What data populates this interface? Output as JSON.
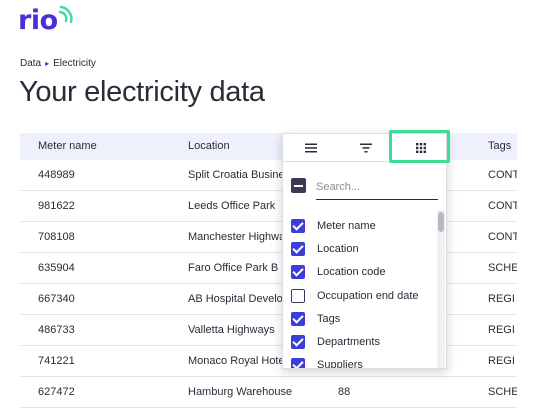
{
  "brand": {
    "logo_text": "rio",
    "accent": "#4b2fd6",
    "arc_color": "#3ddc97"
  },
  "breadcrumb": {
    "items": [
      "Data",
      "Electricity"
    ],
    "separator": "▸"
  },
  "page": {
    "title": "Your electricity data"
  },
  "table": {
    "columns": [
      "Meter name",
      "Location",
      "",
      "Tags"
    ],
    "rows": [
      {
        "meter": "448989",
        "location": "Split Croatia Business",
        "code": "",
        "tags": "CONT"
      },
      {
        "meter": "981622",
        "location": "Leeds Office Park",
        "code": "",
        "tags": "CONT"
      },
      {
        "meter": "708108",
        "location": "Manchester Highway",
        "code": "",
        "tags": "CONT"
      },
      {
        "meter": "635904",
        "location": "Faro Office Park B",
        "code": "",
        "tags": "SCHE"
      },
      {
        "meter": "667340",
        "location": "AB Hospital Development",
        "code": "",
        "tags": "REGI"
      },
      {
        "meter": "486733",
        "location": "Valletta Highways",
        "code": "",
        "tags": "REGI"
      },
      {
        "meter": "741221",
        "location": "Monaco Royal Hotel",
        "code": "",
        "tags": "REGI"
      },
      {
        "meter": "627472",
        "location": "Hamburg Warehouse",
        "code": "88",
        "tags": "SCHE"
      }
    ]
  },
  "column_menu": {
    "tabs": [
      {
        "icon": "menu-lines-icon",
        "active": false
      },
      {
        "icon": "filter-icon",
        "active": false
      },
      {
        "icon": "grid-icon",
        "active": true
      }
    ],
    "highlight_color": "#3ddc97",
    "search_placeholder": "Search...",
    "checkbox_color": "#3b3fd8",
    "columns": [
      {
        "label": "Meter name",
        "checked": true
      },
      {
        "label": "Location",
        "checked": true
      },
      {
        "label": "Location code",
        "checked": true
      },
      {
        "label": "Occupation end date",
        "checked": false
      },
      {
        "label": "Tags",
        "checked": true
      },
      {
        "label": "Departments",
        "checked": true
      },
      {
        "label": "Suppliers",
        "checked": true
      }
    ]
  }
}
